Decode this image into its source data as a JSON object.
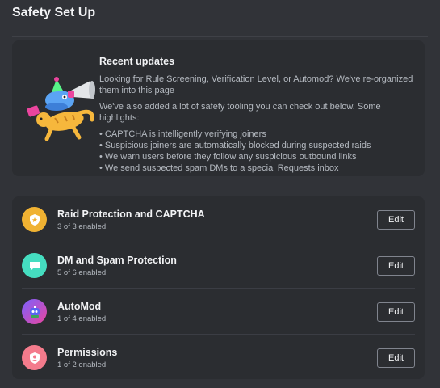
{
  "page": {
    "title": "Safety Set Up"
  },
  "updates": {
    "title": "Recent updates",
    "intro": "Looking for Rule Screening, Verification Level, or Automod? We've re-organized them into this page",
    "highlights_intro": "We've also added a lot of safety tooling you can check out below. Some highlights:",
    "bullets": [
      "CAPTCHA is intelligently verifying joiners",
      "Suspicious joiners are automatically blocked during suspected raids",
      "We warn users before they follow any suspicious outbound links",
      "We send suspected spam DMs to a special Requests inbox"
    ]
  },
  "settings": [
    {
      "title": "Raid Protection and CAPTCHA",
      "status": "3 of 3 enabled",
      "button": "Edit",
      "icon": "shield-icon",
      "color": "#f0b232"
    },
    {
      "title": "DM and Spam Protection",
      "status": "5 of 6 enabled",
      "button": "Edit",
      "icon": "chat-bubble-icon",
      "color": "#45ddc0"
    },
    {
      "title": "AutoMod",
      "status": "1 of 4 enabled",
      "button": "Edit",
      "icon": "automod-robot-icon",
      "color": "#7b61ff"
    },
    {
      "title": "Permissions",
      "status": "1 of 2 enabled",
      "button": "Edit",
      "icon": "shield-person-icon",
      "color": "#f47b8c"
    }
  ],
  "colors": {
    "background": "#313338",
    "card": "#2b2d31",
    "text": "#f2f3f5",
    "muted": "#b5bac1"
  }
}
